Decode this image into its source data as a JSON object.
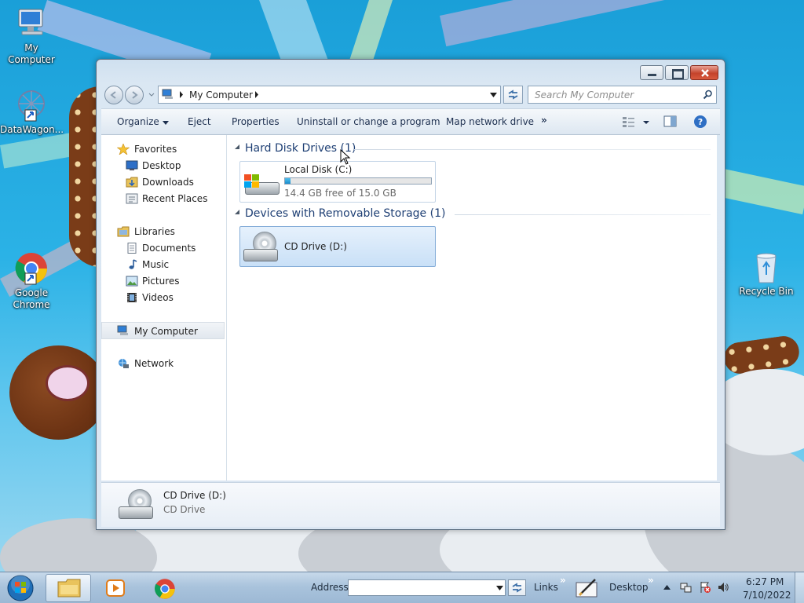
{
  "desktop": {
    "icons": [
      {
        "label": "My Computer",
        "icon": "computer-icon"
      },
      {
        "label": "DataWagon...",
        "icon": "datawagon-icon"
      },
      {
        "label_line1": "Google",
        "label_line2": "Chrome",
        "icon": "chrome-icon"
      },
      {
        "label": "Recycle Bin",
        "icon": "recycle-bin-icon"
      }
    ]
  },
  "window": {
    "address": {
      "path": "My Computer"
    },
    "search": {
      "placeholder": "Search My Computer"
    },
    "toolbar": {
      "organize": "Organize",
      "eject": "Eject",
      "properties": "Properties",
      "uninstall": "Uninstall or change a program",
      "map_drive": "Map network drive",
      "more": "»"
    },
    "nav": {
      "favorites": "Favorites",
      "desktop": "Desktop",
      "downloads": "Downloads",
      "recent": "Recent Places",
      "libraries": "Libraries",
      "documents": "Documents",
      "music": "Music",
      "pictures": "Pictures",
      "videos": "Videos",
      "computer": "My Computer",
      "network": "Network"
    },
    "groups": {
      "hdd_header": "Hard Disk Drives (1)",
      "removable_header": "Devices with Removable Storage (1)"
    },
    "drives": {
      "c": {
        "name": "Local Disk (C:)",
        "free_text": "14.4 GB free of 15.0 GB",
        "used_fraction": 0.04
      },
      "d": {
        "name": "CD Drive (D:)"
      }
    },
    "details": {
      "title": "CD Drive (D:)",
      "subtitle": "CD Drive"
    }
  },
  "taskbar": {
    "address_label": "Address",
    "links_label": "Links",
    "desktop_label": "Desktop",
    "time": "6:27 PM",
    "date": "7/10/2022",
    "chevron": "»"
  },
  "colors": {
    "accent": "#1e3f74",
    "selection": "#c9e0f7",
    "progress": "#1a8ccc"
  }
}
